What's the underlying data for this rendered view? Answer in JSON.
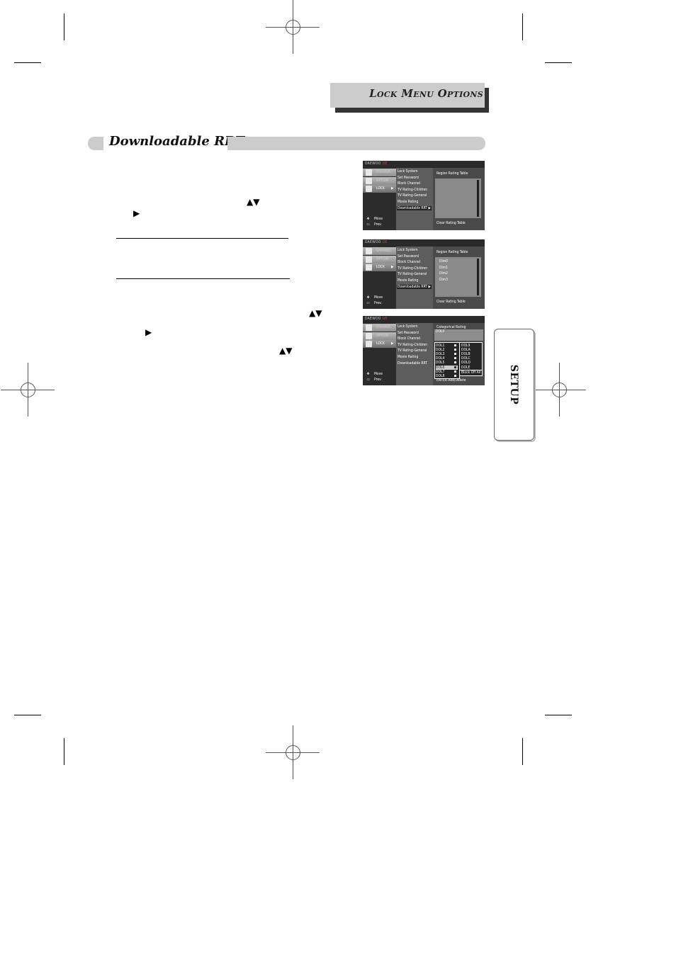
{
  "header": {
    "title": "Lock Menu Options"
  },
  "section": {
    "title": "Downloadable RRT"
  },
  "side_tab": {
    "label": "SETUP"
  },
  "instruction_glyphs": {
    "up_down": "▲▼",
    "right": "▶"
  },
  "screens": [
    {
      "brand": "DAEWOO",
      "brand_suffix": "DE",
      "tabs": [
        {
          "label": "CHANNEL",
          "icon": "tv-icon"
        },
        {
          "label": "OPTION",
          "icon": "gear-icon"
        },
        {
          "label": "LOCK",
          "icon": "lock-icon",
          "selected": true,
          "arrow": "▶"
        }
      ],
      "help": [
        {
          "icon": "move-icon",
          "glyph": "✥",
          "label": "Move"
        },
        {
          "icon": "menu-key-icon",
          "glyph": "▭",
          "label": "Prev."
        }
      ],
      "menu": [
        "Lock System",
        "Set Password",
        "Block Channel",
        "TV Rating-Children",
        "TV Rating-General",
        "Movie Rating",
        "Downloadable RRT ▶"
      ],
      "selected_index": 6,
      "panel_title": "Region Rating Table",
      "panel_items": [],
      "panel_footer": "Clear Rating Table"
    },
    {
      "brand": "DAEWOO",
      "brand_suffix": "DE",
      "tabs": [
        {
          "label": "CHANNEL",
          "icon": "tv-icon"
        },
        {
          "label": "OPTION",
          "icon": "gear-icon"
        },
        {
          "label": "LOCK",
          "icon": "lock-icon",
          "selected": true,
          "arrow": "▶"
        }
      ],
      "help": [
        {
          "icon": "move-icon",
          "glyph": "✥",
          "label": "Move"
        },
        {
          "icon": "menu-key-icon",
          "glyph": "▭",
          "label": "Prev."
        }
      ],
      "menu": [
        "Lock System",
        "Set Password",
        "Block Channel",
        "TV Rating-Children",
        "TV Rating-General",
        "Movie Rating",
        "Downloadable RRT ▶"
      ],
      "selected_index": 6,
      "panel_title": "Region Rating Table",
      "panel_items": [
        "Dim0",
        "Dim1",
        "Dim2",
        "Dim3"
      ],
      "panel_footer": "Clear Rating Table"
    },
    {
      "brand": "DAEWOO",
      "brand_suffix": "DE",
      "tabs": [
        {
          "label": "CHANNEL",
          "icon": "tv-icon"
        },
        {
          "label": "OPTION",
          "icon": "gear-icon"
        },
        {
          "label": "LOCK",
          "icon": "lock-icon",
          "selected": true,
          "arrow": "▶"
        }
      ],
      "help": [
        {
          "icon": "move-icon",
          "glyph": "✥",
          "label": "Move"
        },
        {
          "icon": "menu-key-icon",
          "glyph": "▭",
          "label": "Prev."
        }
      ],
      "menu": [
        "Lock System",
        "Set Password",
        "Block Channel",
        "TV Rating-Children",
        "TV Rating-General",
        "Movie Rating",
        "Downloadable RRT"
      ],
      "selected_index": -1,
      "panel_title": "Categorical Rating",
      "current_value": "DOL0",
      "left_list": [
        {
          "label": "DOL1",
          "locked": true
        },
        {
          "label": "DOL2",
          "locked": true
        },
        {
          "label": "DOL3",
          "locked": true
        },
        {
          "label": "DOL4",
          "locked": true
        },
        {
          "label": "DOL5",
          "locked": true
        },
        {
          "label": "DOL6",
          "locked": true,
          "selected": true
        },
        {
          "label": "DOL7",
          "locked": true
        },
        {
          "label": "DOL8",
          "locked": true
        }
      ],
      "right_list": [
        "DOL9",
        "DOLA",
        "DOLB",
        "DOLC",
        "DOLD",
        "DOLE"
      ],
      "block_off_label": "Block Off All",
      "panel_footer": "ENTER Add/Delete"
    }
  ]
}
